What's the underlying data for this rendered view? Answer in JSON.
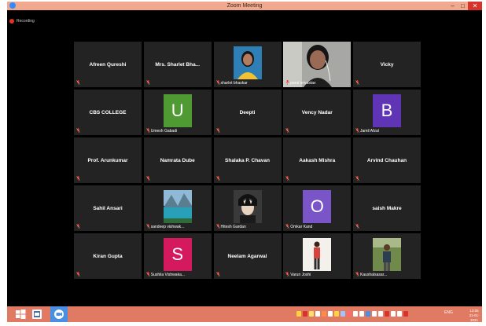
{
  "window": {
    "title": "Zoom Meeting",
    "controls": {
      "minimize": "–",
      "maximize": "□",
      "close": "✕"
    },
    "recording_label": "Recording"
  },
  "participants": [
    {
      "name": "Afreen Qureshi",
      "display": "name"
    },
    {
      "name": "Mrs. Sharlet Bha...",
      "display": "name"
    },
    {
      "name": "sharlet bhaskar",
      "display": "photo",
      "photo_kind": "portrait-girl"
    },
    {
      "name": "parul srivastav",
      "display": "video",
      "active_speaker": true
    },
    {
      "name": "Vicky",
      "display": "name"
    },
    {
      "name": "CBS COLLEGE",
      "display": "name"
    },
    {
      "name": "Umesh Gabadi",
      "display": "avatar",
      "initial": "U",
      "color": "#4f9a33"
    },
    {
      "name": "Deepti",
      "display": "name"
    },
    {
      "name": "Vency Nadar",
      "display": "name"
    },
    {
      "name": "Jamil Afzal",
      "display": "avatar",
      "initial": "B",
      "color": "#5f35b5"
    },
    {
      "name": "Prof. Arunkumar",
      "display": "name"
    },
    {
      "name": "Namrata Dube",
      "display": "name"
    },
    {
      "name": "Shalaka P. Chavan",
      "display": "name"
    },
    {
      "name": "Aakash Mishra",
      "display": "name"
    },
    {
      "name": "Arvind Chauhan",
      "display": "name"
    },
    {
      "name": "Sahil Ansari",
      "display": "name"
    },
    {
      "name": "sandeep vishwak...",
      "display": "photo",
      "photo_kind": "lake-landscape"
    },
    {
      "name": "Hitesh Gardan",
      "display": "photo",
      "photo_kind": "anime-character"
    },
    {
      "name": "Omkar Kand",
      "display": "avatar",
      "initial": "O",
      "color": "#7a55c8"
    },
    {
      "name": "saish Makre",
      "display": "name"
    },
    {
      "name": "Kiran Gupta",
      "display": "name"
    },
    {
      "name": "Sushila Vishwaka...",
      "display": "avatar",
      "initial": "S",
      "color": "#d4195f"
    },
    {
      "name": "Neelam Agarwal",
      "display": "name"
    },
    {
      "name": "Varun Joshi",
      "display": "photo",
      "photo_kind": "standing-person"
    },
    {
      "name": "Kaushalsasar...",
      "display": "photo",
      "photo_kind": "outdoor-person"
    }
  ],
  "icons": {
    "muted_mic": "mic-off-icon"
  },
  "taskbar": {
    "items": [
      {
        "name": "start-button",
        "icon": "windows-icon"
      },
      {
        "name": "taskbar-app-explorer",
        "icon": "folder-icon"
      },
      {
        "name": "taskbar-app-zoom",
        "icon": "zoom-camera-icon"
      }
    ],
    "language": "ENG",
    "time": "13:05",
    "date": "31-01-2021"
  },
  "colors": {
    "titlebar": "#f0a88e",
    "taskbar": "#e07a63",
    "tile_background": "#232323",
    "active_speaker_border": "#c6d73a",
    "muted_mic": "#e5331f"
  }
}
